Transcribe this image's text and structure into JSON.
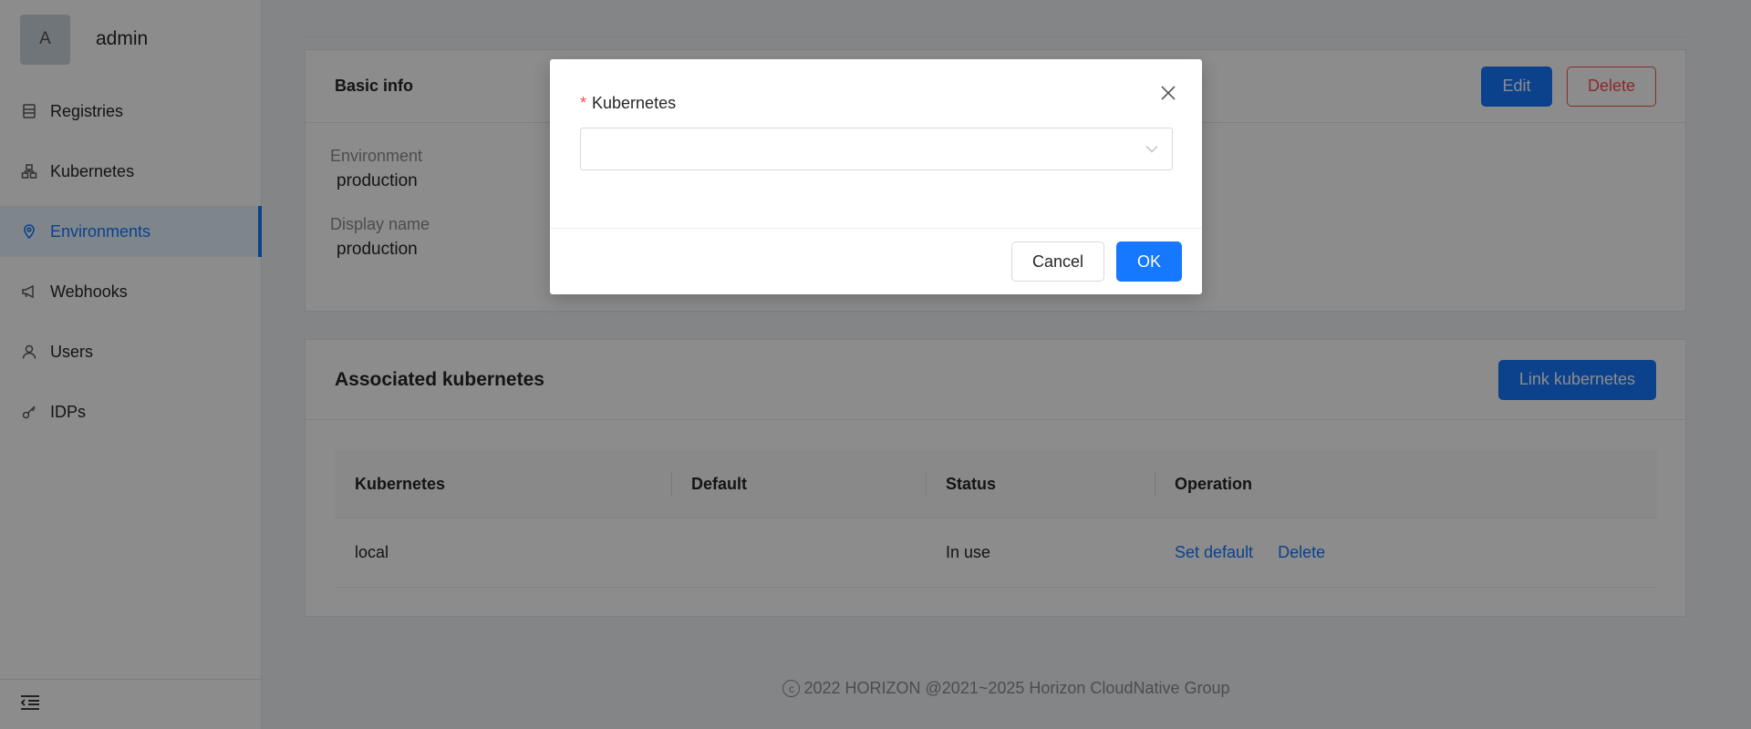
{
  "sidebar": {
    "avatar_letter": "A",
    "username": "admin",
    "items": [
      {
        "label": "Registries",
        "icon": "database-icon"
      },
      {
        "label": "Kubernetes",
        "icon": "cluster-icon"
      },
      {
        "label": "Environments",
        "icon": "location-pin-icon",
        "active": true
      },
      {
        "label": "Webhooks",
        "icon": "megaphone-icon"
      },
      {
        "label": "Users",
        "icon": "user-icon"
      },
      {
        "label": "IDPs",
        "icon": "key-icon"
      }
    ],
    "collapse_icon": "menu-fold-icon"
  },
  "basic_info": {
    "title": "Basic info",
    "edit_label": "Edit",
    "delete_label": "Delete",
    "fields": [
      {
        "label": "Environment",
        "value": "production"
      },
      {
        "label": "Display name",
        "value": "production"
      }
    ]
  },
  "associated": {
    "title": "Associated kubernetes",
    "link_label": "Link kubernetes",
    "columns": [
      "Kubernetes",
      "Default",
      "Status",
      "Operation"
    ],
    "rows": [
      {
        "kubernetes": "local",
        "default": "",
        "status": "In use",
        "actions": [
          "Set default",
          "Delete"
        ]
      }
    ]
  },
  "footer": {
    "text": "2022 HORIZON @2021~2025 Horizon CloudNative Group"
  },
  "modal": {
    "field_label": "Kubernetes",
    "select_value": "",
    "cancel_label": "Cancel",
    "ok_label": "OK"
  },
  "colors": {
    "primary": "#1677ff",
    "danger": "#ff4d4f",
    "mask": "rgba(0,0,0,0.45)"
  }
}
